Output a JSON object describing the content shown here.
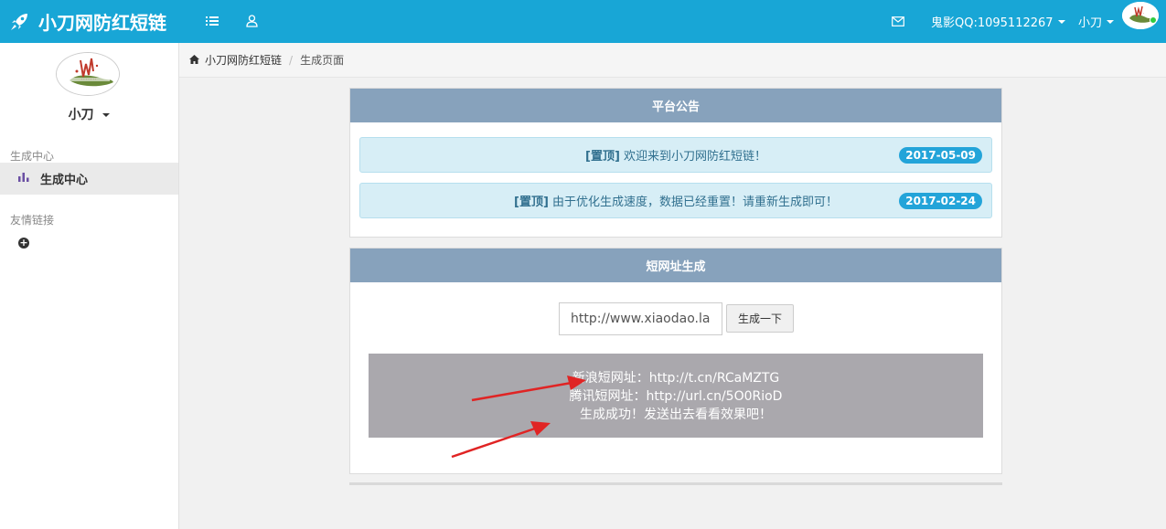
{
  "app": {
    "brand_title": "小刀网防红短链"
  },
  "topbar": {
    "menu_icon": "list-icon",
    "user_icon": "user-icon",
    "mail_icon": "mail-icon",
    "contact_label": "鬼影QQ:1095112267",
    "user_label": "小刀",
    "bg_color": "#18a6d6"
  },
  "sidebar": {
    "username": "小刀",
    "section_generate": "生成中心",
    "active_item": "生成中心",
    "section_links": "友情链接",
    "chart_icon": "bar-chart-icon",
    "add_icon": "plus-circle-icon"
  },
  "breadcrumb": {
    "home_icon": "home-icon",
    "home": "小刀网防红短链",
    "current": "生成页面"
  },
  "announcement": {
    "title": "平台公告",
    "items": [
      {
        "tag": "[置顶]",
        "text": "欢迎来到小刀网防红短链！",
        "date": "2017-05-09"
      },
      {
        "tag": "[置顶]",
        "text": "由于优化生成速度，数据已经重置！请重新生成即可！",
        "date": "2017-02-24"
      }
    ]
  },
  "generator": {
    "title": "短网址生成",
    "input_value": "http://www.xiaodao.la",
    "button_label": "生成一下",
    "result_lines": [
      "新浪短网址：http://t.cn/RCaMZTG",
      "腾讯短网址：http://url.cn/5O0RioD",
      "生成成功！发送出去看看效果吧！"
    ]
  }
}
